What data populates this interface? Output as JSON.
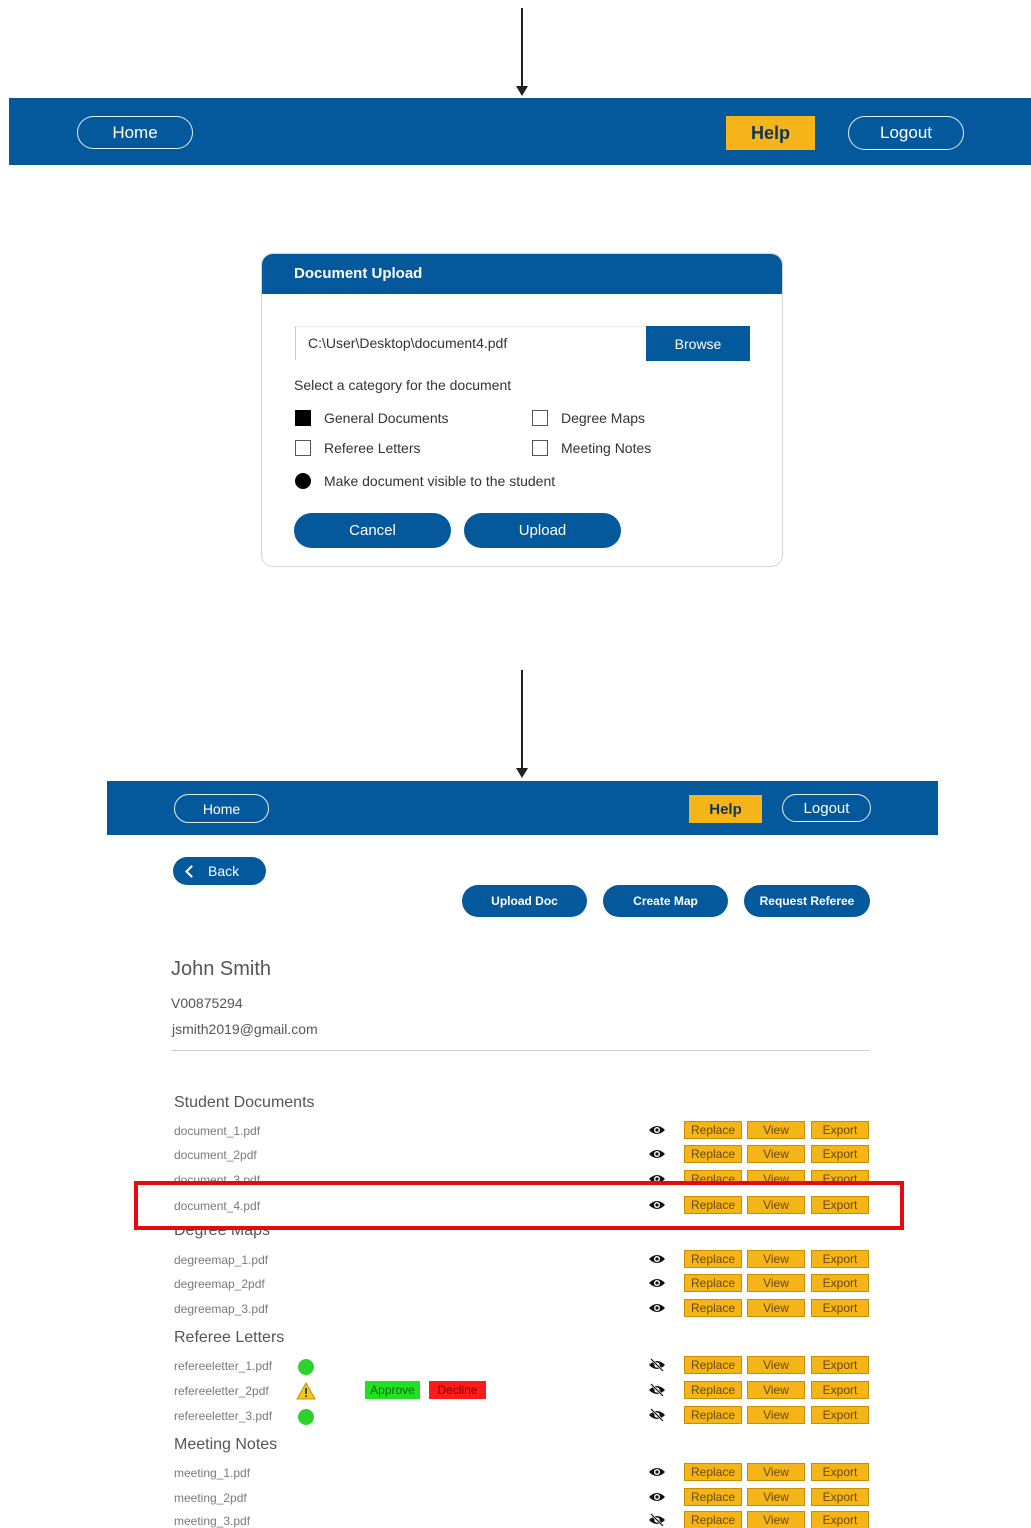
{
  "top_nav": {
    "home": "Home",
    "help": "Help",
    "logout": "Logout"
  },
  "upload_dialog": {
    "title": "Document Upload",
    "file_path": "C:\\User\\Desktop\\document4.pdf",
    "browse": "Browse",
    "category_prompt": "Select a category  for the document",
    "categories": [
      {
        "label": "General Documents",
        "checked": true
      },
      {
        "label": "Degree Maps",
        "checked": false
      },
      {
        "label": "Referee Letters",
        "checked": false
      },
      {
        "label": "Meeting Notes",
        "checked": false
      }
    ],
    "visible_option": "Make document visible to the student",
    "cancel": "Cancel",
    "upload": "Upload"
  },
  "profile_nav": {
    "home": "Home",
    "help": "Help",
    "logout": "Logout"
  },
  "profile": {
    "back": "Back",
    "actions": {
      "upload_doc": "Upload Doc",
      "create_map": "Create Map",
      "request_referee": "Request Referee"
    },
    "name": "John Smith",
    "id": "V00875294",
    "email": "jsmith2019@gmail.com"
  },
  "row_buttons": {
    "replace": "Replace",
    "view": "View",
    "export": "Export"
  },
  "approval": {
    "approve": "Approve",
    "decline": "Decline"
  },
  "sections": {
    "student_documents": {
      "title": "Student Documents",
      "files": [
        "document_1.pdf",
        "document_2pdf",
        "document_3.pdf",
        "document_4.pdf"
      ]
    },
    "degree_maps": {
      "title": "Degree Maps",
      "files": [
        "degreemap_1.pdf",
        "degreemap_2pdf",
        "degreemap_3.pdf"
      ]
    },
    "referee_letters": {
      "title": "Referee Letters",
      "files": [
        "refereeletter_1.pdf",
        "refereeletter_2pdf",
        "refereeletter_3.pdf"
      ]
    },
    "meeting_notes": {
      "title": "Meeting Notes",
      "files": [
        "meeting_1.pdf",
        "meeting_2pdf",
        "meeting_3.pdf"
      ]
    }
  },
  "colors": {
    "brand_blue": "#04589c",
    "accent_yellow": "#f5b518",
    "highlight_red": "#e8090f",
    "approve_green": "#22e022",
    "decline_red": "#ff1a1a"
  }
}
